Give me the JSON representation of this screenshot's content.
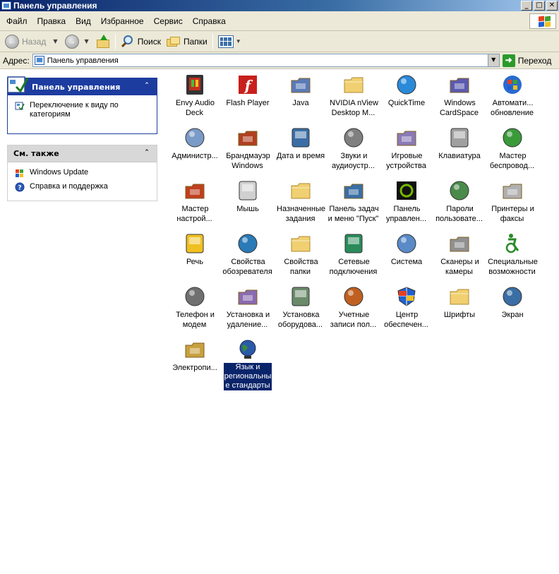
{
  "window": {
    "title": "Панель управления",
    "minimize": "_",
    "maximize": "□",
    "close": "✕"
  },
  "menu": [
    "Файл",
    "Правка",
    "Вид",
    "Избранное",
    "Сервис",
    "Справка"
  ],
  "toolbar": {
    "back_label": "Назад",
    "search_label": "Поиск",
    "folders_label": "Папки"
  },
  "address": {
    "label": "Адрес:",
    "value": "Панель управления",
    "go_label": "Переход"
  },
  "tasks_panel": {
    "title": "Панель управления",
    "switch_view_label": "Переключение к виду по категориям"
  },
  "see_also_panel": {
    "title": "См. также",
    "links": [
      "Windows Update",
      "Справка и поддержка"
    ]
  },
  "icons": [
    {
      "label": "Envy Audio\nDeck",
      "icon": "audio-deck-icon",
      "color": "#2a2a2a"
    },
    {
      "label": "Flash Player",
      "icon": "flash-icon",
      "color": "#c8201c"
    },
    {
      "label": "Java",
      "icon": "java-icon",
      "color": "#5a7ab8"
    },
    {
      "label": "NVIDIA nView\nDesktop M...",
      "icon": "folder-icon",
      "color": "#f0d070"
    },
    {
      "label": "QuickTime",
      "icon": "quicktime-icon",
      "color": "#2a8ad8"
    },
    {
      "label": "Windows\nCardSpace",
      "icon": "cardspace-icon",
      "color": "#5a5ab0"
    },
    {
      "label": "Автомати...\nобновление",
      "icon": "windows-update-icon",
      "color": "#2a8a2a"
    },
    {
      "label": "Администр...",
      "icon": "admin-tools-icon",
      "color": "#7a9ac8"
    },
    {
      "label": "Брандмауэр\nWindows",
      "icon": "firewall-icon",
      "color": "#b04020"
    },
    {
      "label": "Дата и время",
      "icon": "clock-icon",
      "color": "#3a6ea5"
    },
    {
      "label": "Звуки и\nаудиоустр...",
      "icon": "speaker-icon",
      "color": "#808080"
    },
    {
      "label": "Игровые\nустройства",
      "icon": "gamepad-icon",
      "color": "#8a7ab8"
    },
    {
      "label": "Клавиатура",
      "icon": "keyboard-icon",
      "color": "#a0a0a0"
    },
    {
      "label": "Мастер\nбеспровод...",
      "icon": "wireless-icon",
      "color": "#3a9a3a"
    },
    {
      "label": "Мастер\nнастрой...",
      "icon": "network-setup-icon",
      "color": "#c04020"
    },
    {
      "label": "Мышь",
      "icon": "mouse-icon",
      "color": "#d0d0d0"
    },
    {
      "label": "Назначенные\nзадания",
      "icon": "scheduled-tasks-icon",
      "color": "#f0d070"
    },
    {
      "label": "Панель задач\nи меню \"Пуск\"",
      "icon": "taskbar-icon",
      "color": "#3a6ea5"
    },
    {
      "label": "Панель\nуправлен...",
      "icon": "nvidia-icon",
      "color": "#76b900"
    },
    {
      "label": "Пароли\nпользовате...",
      "icon": "passwords-icon",
      "color": "#4a8a4a"
    },
    {
      "label": "Принтеры и\nфаксы",
      "icon": "printer-icon",
      "color": "#b0b0b0"
    },
    {
      "label": "Речь",
      "icon": "speech-icon",
      "color": "#f0c020"
    },
    {
      "label": "Свойства\nобозревателя",
      "icon": "internet-options-icon",
      "color": "#2a7ab8"
    },
    {
      "label": "Свойства\nпапки",
      "icon": "folder-options-icon",
      "color": "#f0d070"
    },
    {
      "label": "Сетевые\nподключения",
      "icon": "network-connections-icon",
      "color": "#2a8a5a"
    },
    {
      "label": "Система",
      "icon": "system-icon",
      "color": "#5a8ac8"
    },
    {
      "label": "Сканеры и\nкамеры",
      "icon": "scanner-icon",
      "color": "#909090"
    },
    {
      "label": "Специальные\nвозможности",
      "icon": "accessibility-icon",
      "color": "#2a8a2a"
    },
    {
      "label": "Телефон и\nмодем",
      "icon": "phone-icon",
      "color": "#707070"
    },
    {
      "label": "Установка и\nудаление...",
      "icon": "add-remove-icon",
      "color": "#8a6ab0"
    },
    {
      "label": "Установка\nоборудова...",
      "icon": "add-hardware-icon",
      "color": "#6a8a6a"
    },
    {
      "label": "Учетные\nзаписи пол...",
      "icon": "user-accounts-icon",
      "color": "#c06020"
    },
    {
      "label": "Центр\nобеспечен...",
      "icon": "security-center-icon",
      "color": "#d03020"
    },
    {
      "label": "Шрифты",
      "icon": "fonts-icon",
      "color": "#f0d070"
    },
    {
      "label": "Экран",
      "icon": "display-icon",
      "color": "#3a6ea5"
    },
    {
      "label": "Электропи...",
      "icon": "power-options-icon",
      "color": "#c8a040"
    },
    {
      "label": "Язык и\nрегиональны\nе стандарты",
      "icon": "globe-icon",
      "color": "#2a4a8a",
      "selected": true
    }
  ]
}
